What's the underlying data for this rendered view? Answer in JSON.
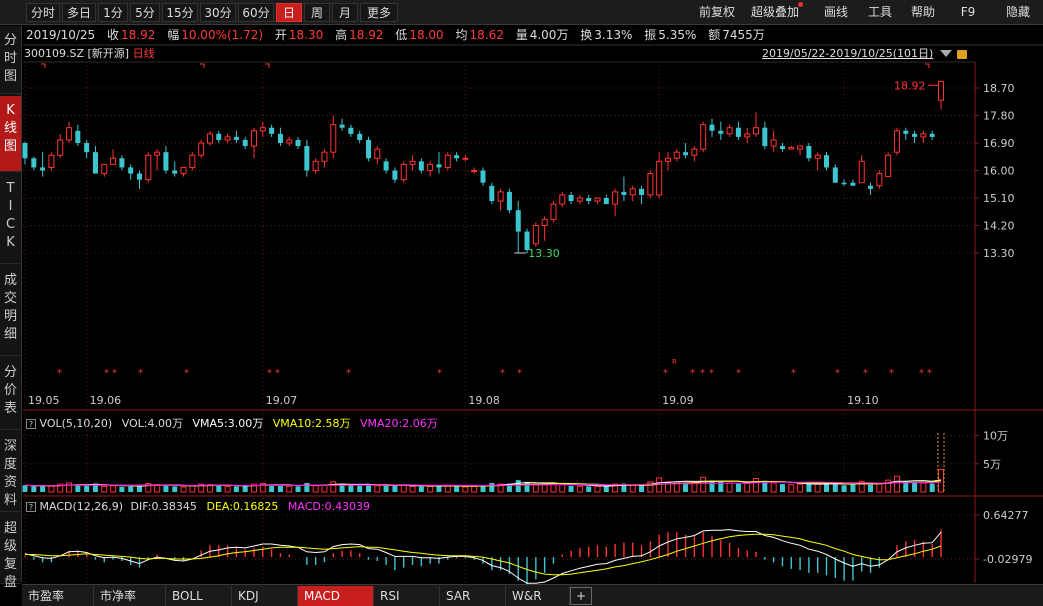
{
  "toolbar": {
    "left_buttons": [
      {
        "label": "分时",
        "active": false
      },
      {
        "label": "多日",
        "active": false
      },
      {
        "label": "1分",
        "active": false
      },
      {
        "label": "5分",
        "active": false
      },
      {
        "label": "15分",
        "active": false
      },
      {
        "label": "30分",
        "active": false
      },
      {
        "label": "60分",
        "active": false
      },
      {
        "label": "日",
        "active": true
      },
      {
        "label": "周",
        "active": false
      },
      {
        "label": "月",
        "active": false
      },
      {
        "label": "更多",
        "active": false
      }
    ],
    "right_buttons": [
      "前复权",
      "超级叠加",
      "画线",
      "工具",
      "帮助",
      "F9",
      "隐藏"
    ]
  },
  "sidebar": {
    "tabs": [
      {
        "label": "分\n时\n图",
        "active": false
      },
      {
        "label": "K\n线\n图",
        "active": true
      },
      {
        "label": "T\nI\nC\nK",
        "active": false
      },
      {
        "label": "成\n交\n明\n细",
        "active": false
      },
      {
        "label": "分\n价\n表",
        "active": false
      },
      {
        "label": "深\n度\n资\n料",
        "active": false
      },
      {
        "label": "超\n级\n复\n盘",
        "active": false
      }
    ]
  },
  "quote": {
    "date": "2019/10/25",
    "close_label": "收",
    "close": "18.92",
    "change_label": "幅",
    "change": "10.00%(1.72)",
    "open_label": "开",
    "open": "18.30",
    "high_label": "高",
    "high": "18.92",
    "low_label": "低",
    "low": "18.00",
    "avg_label": "均",
    "avg": "18.62",
    "volume_label": "量",
    "volume": "4.00万",
    "turnover_label": "换",
    "turnover": "3.13%",
    "amplitude_label": "振",
    "amplitude": "5.35%",
    "amount_label": "额",
    "amount": "7455万"
  },
  "chart_header": {
    "symbol": "300109.SZ",
    "source": "[新开源]",
    "period": "日线",
    "range": "2019/05/22-2019/10/25(101日)"
  },
  "annotations": {
    "max_label": "18.92",
    "min_label": "13.30"
  },
  "colors": {
    "up": "#ff3232",
    "down": "#3cc6d0",
    "grid": "#5a1a1a",
    "axis": "#8a1a1a",
    "ma5": "#ffffff",
    "ma10": "#ffff00",
    "ma20": "#ff00ff"
  },
  "volume_panel": {
    "title": "VOL(5,10,20)",
    "vol": "VOL:4.00万",
    "vma5": "VMA5:3.00万",
    "vma10": "VMA10:2.58万",
    "vma20": "VMA20:2.06万",
    "axis_ticks": [
      "10万",
      "5万"
    ]
  },
  "macd_panel": {
    "title": "MACD(12,26,9)",
    "dif": "DIF:0.38345",
    "dea": "DEA:0.16825",
    "macd": "MACD:0.43039",
    "axis_ticks": [
      "0.64277",
      "-0.02979"
    ]
  },
  "bottom_tabs": [
    {
      "label": "市盈率",
      "active": false
    },
    {
      "label": "市净率",
      "active": false
    },
    {
      "label": "BOLL",
      "active": false
    },
    {
      "label": "KDJ",
      "active": false
    },
    {
      "label": "MACD",
      "active": true
    },
    {
      "label": "RSI",
      "active": false
    },
    {
      "label": "SAR",
      "active": false
    },
    {
      "label": "W&R",
      "active": false
    },
    {
      "label": "+",
      "active": false
    }
  ],
  "chart_data": {
    "type": "candlestick",
    "price_axis_ticks": [
      18.7,
      17.8,
      16.9,
      16.0,
      15.1,
      14.2,
      13.3
    ],
    "x_ticks": [
      "19.05",
      "19.06",
      "19.07",
      "19.08",
      "19.09",
      "19.10"
    ],
    "x_tick_index": [
      0,
      7,
      27,
      50,
      72,
      93
    ],
    "ohlc": [
      [
        16.9,
        16.95,
        16.2,
        16.4
      ],
      [
        16.4,
        16.45,
        16.0,
        16.1
      ],
      [
        16.1,
        16.6,
        15.8,
        16.0
      ],
      [
        16.1,
        16.6,
        16.0,
        16.5
      ],
      [
        16.5,
        17.2,
        16.4,
        17.0
      ],
      [
        17.0,
        17.6,
        16.9,
        17.4
      ],
      [
        17.3,
        17.5,
        16.8,
        16.9
      ],
      [
        16.9,
        17.0,
        16.4,
        16.6
      ],
      [
        16.6,
        16.8,
        15.9,
        15.9
      ],
      [
        15.9,
        16.2,
        15.8,
        16.2
      ],
      [
        16.2,
        16.7,
        16.2,
        16.4
      ],
      [
        16.4,
        16.5,
        16.0,
        16.1
      ],
      [
        16.1,
        16.2,
        15.7,
        15.9
      ],
      [
        15.9,
        16.0,
        15.4,
        15.7
      ],
      [
        15.7,
        16.6,
        15.6,
        16.5
      ],
      [
        16.5,
        16.7,
        16.0,
        16.6
      ],
      [
        16.6,
        16.8,
        15.9,
        16.0
      ],
      [
        16.0,
        16.3,
        15.8,
        15.9
      ],
      [
        15.9,
        16.1,
        15.8,
        16.1
      ],
      [
        16.1,
        16.6,
        16.0,
        16.5
      ],
      [
        16.5,
        17.0,
        16.4,
        16.9
      ],
      [
        16.9,
        17.3,
        16.8,
        17.2
      ],
      [
        17.2,
        17.3,
        16.9,
        17.0
      ],
      [
        17.0,
        17.2,
        16.9,
        17.1
      ],
      [
        17.1,
        17.3,
        16.9,
        17.0
      ],
      [
        17.0,
        17.1,
        16.7,
        16.8
      ],
      [
        16.8,
        17.4,
        16.4,
        17.3
      ],
      [
        17.3,
        17.6,
        17.1,
        17.4
      ],
      [
        17.4,
        17.5,
        17.1,
        17.2
      ],
      [
        17.2,
        17.4,
        16.8,
        16.9
      ],
      [
        16.9,
        17.1,
        16.8,
        17.0
      ],
      [
        17.0,
        17.1,
        16.7,
        16.8
      ],
      [
        16.8,
        17.0,
        15.8,
        16.0
      ],
      [
        16.0,
        16.4,
        15.9,
        16.3
      ],
      [
        16.3,
        16.7,
        16.1,
        16.6
      ],
      [
        16.6,
        17.8,
        16.4,
        17.5
      ],
      [
        17.5,
        17.7,
        17.3,
        17.4
      ],
      [
        17.4,
        17.5,
        17.1,
        17.2
      ],
      [
        17.2,
        17.3,
        16.9,
        17.0
      ],
      [
        17.0,
        17.1,
        16.3,
        16.4
      ],
      [
        16.4,
        16.8,
        16.2,
        16.7
      ],
      [
        16.3,
        16.4,
        15.9,
        16.0
      ],
      [
        16.0,
        16.1,
        15.6,
        15.7
      ],
      [
        15.7,
        16.3,
        15.6,
        16.2
      ],
      [
        16.2,
        16.5,
        16.0,
        16.3
      ],
      [
        16.3,
        16.4,
        15.9,
        16.0
      ],
      [
        16.0,
        16.3,
        15.8,
        16.2
      ],
      [
        16.2,
        16.6,
        15.9,
        16.1
      ],
      [
        16.1,
        16.6,
        16.0,
        16.5
      ],
      [
        16.5,
        16.6,
        16.3,
        16.4
      ],
      [
        16.4,
        16.5,
        16.3,
        16.4
      ],
      [
        16.0,
        16.1,
        15.9,
        16.0
      ],
      [
        16.0,
        16.1,
        15.5,
        15.6
      ],
      [
        15.5,
        15.6,
        14.9,
        15.0
      ],
      [
        15.0,
        15.4,
        14.7,
        15.3
      ],
      [
        15.3,
        15.4,
        14.6,
        14.7
      ],
      [
        14.7,
        15.0,
        13.3,
        14.0
      ],
      [
        14.0,
        14.1,
        13.3,
        13.4
      ],
      [
        13.6,
        14.3,
        13.5,
        14.2
      ],
      [
        14.2,
        14.5,
        13.7,
        14.4
      ],
      [
        14.4,
        15.0,
        14.3,
        14.9
      ],
      [
        14.9,
        15.3,
        14.8,
        15.2
      ],
      [
        15.2,
        15.3,
        14.9,
        15.0
      ],
      [
        15.0,
        15.2,
        14.9,
        15.1
      ],
      [
        15.1,
        15.2,
        14.9,
        15.0
      ],
      [
        15.0,
        15.1,
        14.9,
        15.1
      ],
      [
        15.1,
        15.2,
        14.9,
        14.9
      ],
      [
        14.9,
        15.4,
        14.5,
        15.3
      ],
      [
        15.3,
        15.8,
        15.0,
        15.2
      ],
      [
        15.2,
        15.5,
        15.0,
        15.4
      ],
      [
        15.4,
        15.5,
        14.9,
        15.2
      ],
      [
        15.2,
        16.0,
        15.1,
        15.9
      ],
      [
        15.2,
        16.6,
        15.1,
        16.3
      ],
      [
        16.3,
        16.6,
        16.0,
        16.4
      ],
      [
        16.4,
        16.7,
        16.3,
        16.6
      ],
      [
        16.6,
        16.9,
        16.4,
        16.5
      ],
      [
        16.5,
        16.8,
        16.3,
        16.7
      ],
      [
        16.7,
        17.6,
        16.6,
        17.5
      ],
      [
        17.5,
        17.7,
        17.1,
        17.3
      ],
      [
        17.3,
        17.6,
        17.0,
        17.2
      ],
      [
        17.2,
        17.5,
        17.1,
        17.4
      ],
      [
        17.4,
        17.6,
        17.0,
        17.1
      ],
      [
        17.1,
        17.4,
        16.9,
        17.2
      ],
      [
        17.2,
        17.9,
        17.1,
        17.4
      ],
      [
        17.4,
        17.6,
        16.7,
        16.8
      ],
      [
        16.8,
        17.3,
        16.6,
        17.0
      ],
      [
        16.8,
        16.9,
        16.6,
        16.7
      ],
      [
        16.7,
        16.8,
        16.7,
        16.75
      ],
      [
        16.7,
        16.8,
        16.5,
        16.8
      ],
      [
        16.8,
        16.9,
        16.3,
        16.4
      ],
      [
        16.4,
        16.6,
        16.0,
        16.5
      ],
      [
        16.5,
        16.6,
        16.0,
        16.1
      ],
      [
        16.1,
        16.2,
        15.6,
        15.6
      ],
      [
        15.6,
        15.7,
        15.5,
        15.55
      ],
      [
        15.6,
        15.7,
        15.5,
        15.5
      ],
      [
        15.6,
        16.5,
        15.6,
        16.3
      ],
      [
        15.5,
        15.6,
        15.2,
        15.4
      ],
      [
        15.5,
        16.0,
        15.4,
        15.9
      ],
      [
        15.8,
        16.6,
        15.8,
        16.5
      ],
      [
        16.6,
        17.4,
        16.5,
        17.3
      ],
      [
        17.3,
        17.4,
        17.0,
        17.2
      ],
      [
        17.2,
        17.3,
        16.9,
        17.1
      ],
      [
        17.1,
        17.3,
        16.9,
        17.2
      ],
      [
        17.2,
        17.3,
        17.0,
        17.1
      ],
      [
        18.3,
        18.92,
        18.0,
        18.92
      ]
    ],
    "volume": [
      1.2,
      1.0,
      1.1,
      1.0,
      1.4,
      1.6,
      1.3,
      1.1,
      1.5,
      1.0,
      1.1,
      0.9,
      1.0,
      1.2,
      1.5,
      1.3,
      1.2,
      1.0,
      0.9,
      1.1,
      1.4,
      1.3,
      1.1,
      1.0,
      1.0,
      1.1,
      1.4,
      1.5,
      1.2,
      1.1,
      1.0,
      1.0,
      1.6,
      1.1,
      1.2,
      1.8,
      1.4,
      1.2,
      1.1,
      1.3,
      1.1,
      1.1,
      1.2,
      1.2,
      1.0,
      1.0,
      1.0,
      1.1,
      1.2,
      1.0,
      0.9,
      1.0,
      1.2,
      1.6,
      1.4,
      1.5,
      2.1,
      1.8,
      1.4,
      1.3,
      1.5,
      1.4,
      1.1,
      1.0,
      1.0,
      1.0,
      1.1,
      1.4,
      1.5,
      1.2,
      1.2,
      1.8,
      2.5,
      1.8,
      1.8,
      1.6,
      1.7,
      2.6,
      2.0,
      1.8,
      1.6,
      1.5,
      1.5,
      2.4,
      2.0,
      1.6,
      1.4,
      1.3,
      1.4,
      1.5,
      1.4,
      1.5,
      1.5,
      1.2,
      1.4,
      1.9,
      1.3,
      1.5,
      2.1,
      2.8,
      1.9,
      1.7,
      1.6,
      1.5,
      4.0
    ],
    "vol_axis_max": 11,
    "macd_axis": [
      -0.35,
      0.64277
    ],
    "dif": [
      0.05,
      0.02,
      -0.01,
      -0.02,
      0.02,
      0.08,
      0.09,
      0.07,
      0.02,
      -0.01,
      0.0,
      -0.02,
      -0.06,
      -0.1,
      -0.04,
      0.0,
      -0.02,
      -0.05,
      -0.06,
      -0.03,
      0.03,
      0.09,
      0.11,
      0.14,
      0.15,
      0.14,
      0.17,
      0.2,
      0.2,
      0.18,
      0.17,
      0.15,
      0.08,
      0.07,
      0.08,
      0.16,
      0.19,
      0.2,
      0.19,
      0.13,
      0.12,
      0.07,
      0.01,
      0.01,
      0.01,
      -0.01,
      -0.01,
      -0.02,
      0.0,
      0.01,
      0.01,
      -0.01,
      -0.05,
      -0.13,
      -0.16,
      -0.22,
      -0.32,
      -0.4,
      -0.4,
      -0.38,
      -0.32,
      -0.25,
      -0.21,
      -0.17,
      -0.14,
      -0.11,
      -0.1,
      -0.05,
      -0.02,
      0.01,
      0.02,
      0.08,
      0.17,
      0.23,
      0.28,
      0.3,
      0.33,
      0.4,
      0.41,
      0.41,
      0.42,
      0.4,
      0.39,
      0.39,
      0.33,
      0.3,
      0.25,
      0.21,
      0.18,
      0.12,
      0.09,
      0.04,
      -0.03,
      -0.09,
      -0.14,
      -0.1,
      -0.14,
      -0.12,
      -0.04,
      0.08,
      0.14,
      0.18,
      0.21,
      0.22,
      0.38
    ],
    "dea": [
      0.04,
      0.04,
      0.03,
      0.02,
      0.02,
      0.03,
      0.04,
      0.05,
      0.04,
      0.03,
      0.02,
      0.01,
      0.0,
      -0.02,
      -0.03,
      -0.02,
      -0.02,
      -0.03,
      -0.03,
      -0.03,
      -0.02,
      0.0,
      0.02,
      0.05,
      0.07,
      0.08,
      0.1,
      0.12,
      0.14,
      0.15,
      0.15,
      0.15,
      0.14,
      0.13,
      0.12,
      0.13,
      0.14,
      0.15,
      0.16,
      0.15,
      0.15,
      0.13,
      0.11,
      0.09,
      0.07,
      0.06,
      0.04,
      0.03,
      0.02,
      0.02,
      0.02,
      0.01,
      0.0,
      -0.03,
      -0.06,
      -0.09,
      -0.14,
      -0.19,
      -0.23,
      -0.26,
      -0.27,
      -0.27,
      -0.26,
      -0.24,
      -0.22,
      -0.2,
      -0.18,
      -0.15,
      -0.13,
      -0.1,
      -0.07,
      -0.04,
      0.0,
      0.04,
      0.09,
      0.13,
      0.17,
      0.21,
      0.25,
      0.28,
      0.31,
      0.33,
      0.34,
      0.35,
      0.35,
      0.34,
      0.32,
      0.3,
      0.28,
      0.24,
      0.21,
      0.18,
      0.13,
      0.09,
      0.04,
      0.01,
      -0.02,
      -0.04,
      -0.04,
      -0.01,
      0.02,
      0.05,
      0.09,
      0.12,
      0.17
    ]
  }
}
